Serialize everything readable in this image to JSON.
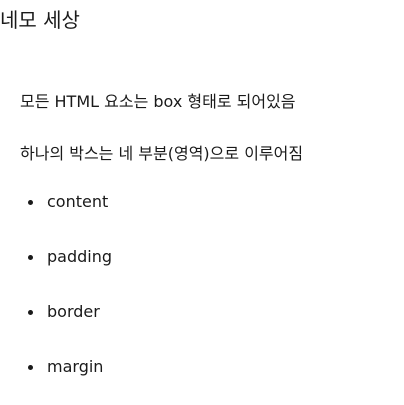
{
  "title": "네모 세상",
  "paragraphs": [
    "모든 HTML 요소는 box 형태로 되어있음",
    "하나의 박스는 네 부분(영역)으로 이루어짐"
  ],
  "bullets": [
    "content",
    "padding",
    "border",
    "margin"
  ]
}
